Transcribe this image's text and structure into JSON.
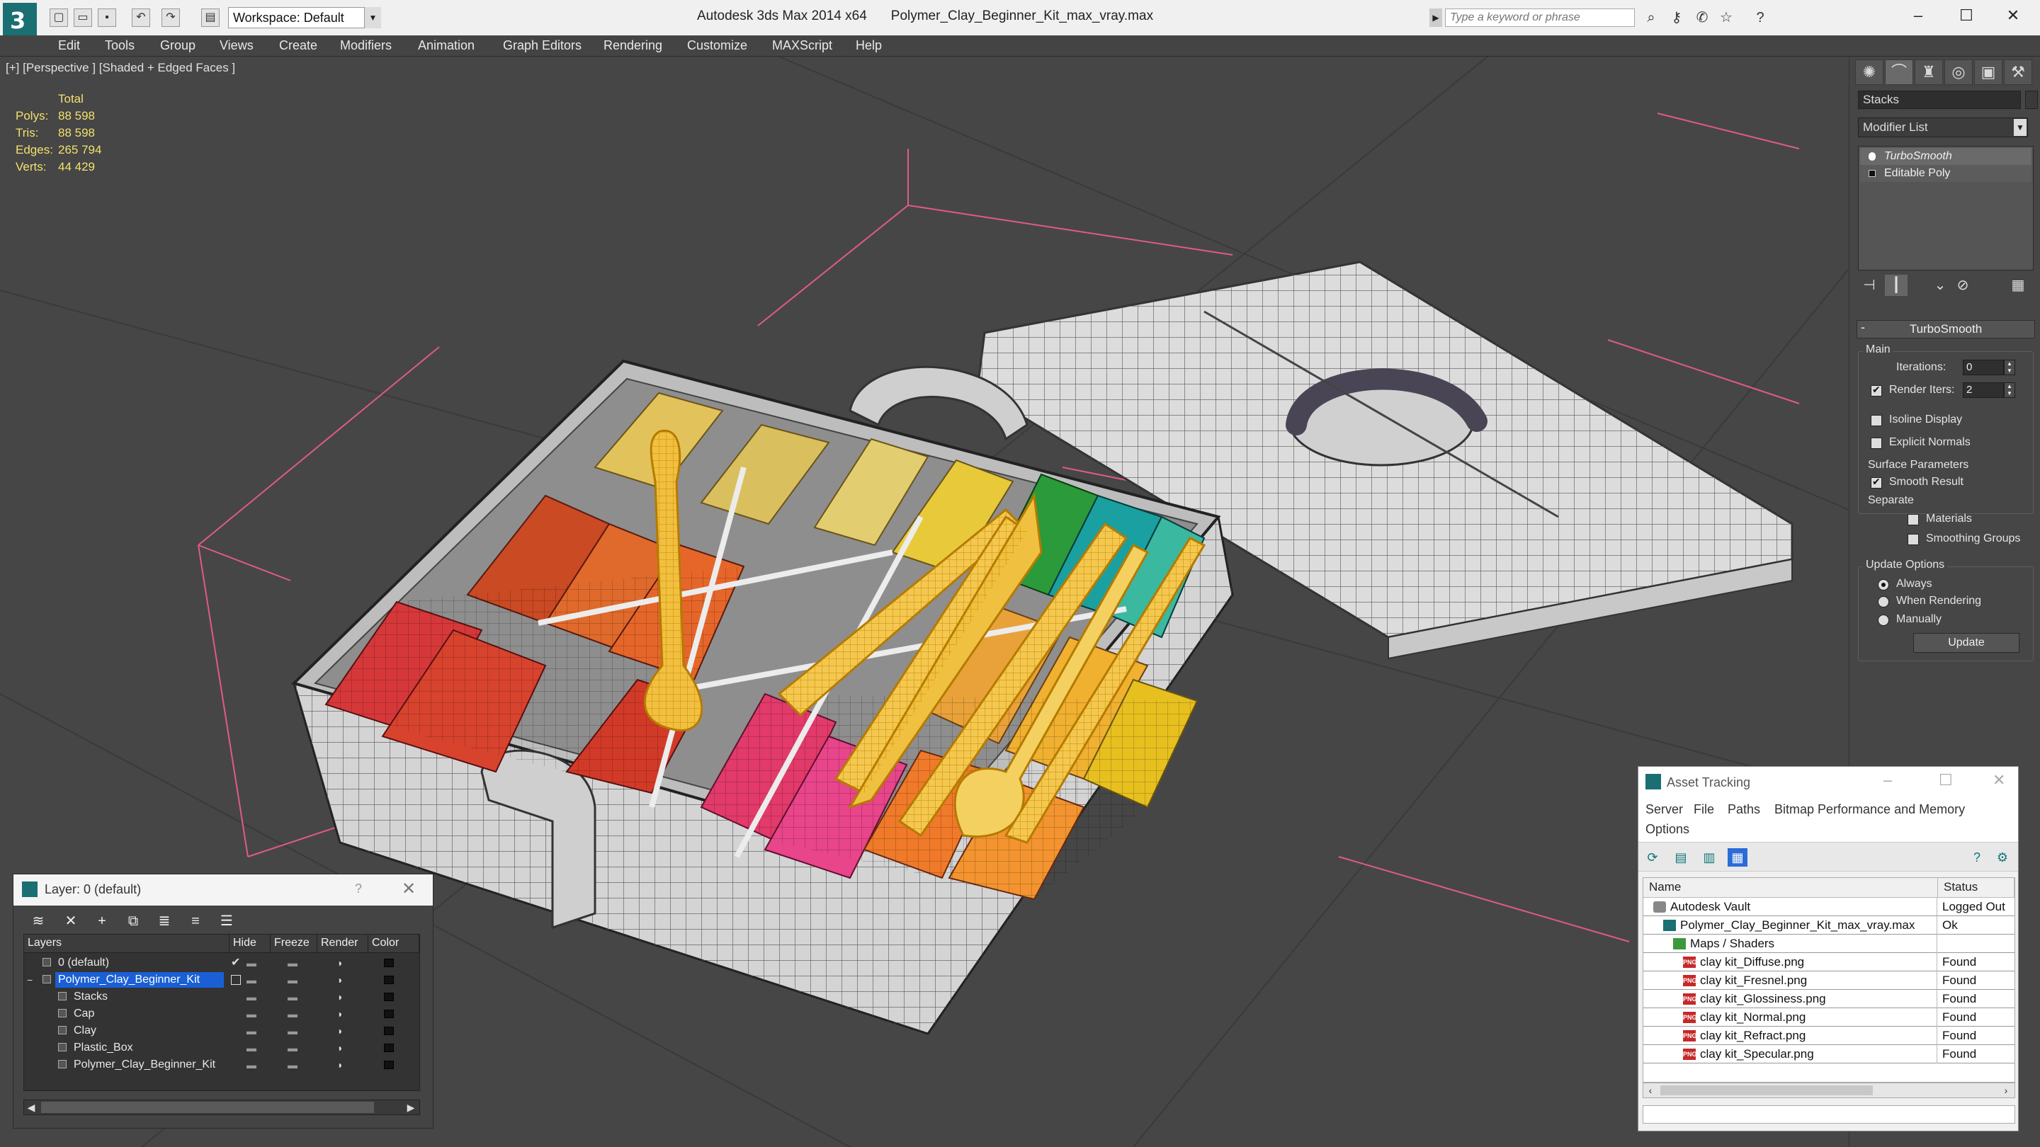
{
  "titlebar": {
    "workspace": "Workspace: Default",
    "app_name": "Autodesk 3ds Max  2014 x64",
    "file_name": "Polymer_Clay_Beginner_Kit_max_vray.max",
    "search_placeholder": "Type a keyword or phrase"
  },
  "menu": {
    "items": [
      "Edit",
      "Tools",
      "Group",
      "Views",
      "Create",
      "Modifiers",
      "Animation",
      "Graph Editors",
      "Rendering",
      "Customize",
      "MAXScript",
      "Help"
    ]
  },
  "viewport": {
    "label": "[+] [Perspective ] [Shaded + Edged Faces ]",
    "stats": {
      "header": "Total",
      "rows": [
        {
          "label": "Polys:",
          "value": "88 598"
        },
        {
          "label": "Tris:",
          "value": "88 598"
        },
        {
          "label": "Edges:",
          "value": "265 794"
        },
        {
          "label": "Verts:",
          "value": "44 429"
        }
      ]
    }
  },
  "command_panel": {
    "stack_name": "Stacks",
    "modifier_list": "Modifier List",
    "stack": [
      "TurboSmooth",
      "Editable Poly"
    ],
    "rollout": "TurboSmooth",
    "main": {
      "title": "Main",
      "iterations_label": "Iterations:",
      "iterations_value": "0",
      "render_iters_label": "Render Iters:",
      "render_iters_value": "2",
      "render_iters_checked": true,
      "isoline": "Isoline Display",
      "explicit_normals": "Explicit Normals"
    },
    "surface": {
      "title": "Surface Parameters",
      "smooth_result": "Smooth Result",
      "separate": "Separate",
      "materials": "Materials",
      "smoothing_groups": "Smoothing Groups"
    },
    "update": {
      "title": "Update Options",
      "always": "Always",
      "when_rendering": "When Rendering",
      "manually": "Manually",
      "button": "Update"
    }
  },
  "layer_dialog": {
    "title": "Layer: 0 (default)",
    "help": "?",
    "columns": {
      "layers": "Layers",
      "hide": "Hide",
      "freeze": "Freeze",
      "render": "Render",
      "color": "Color"
    },
    "rows": [
      {
        "name": "0 (default)",
        "level": 0
      },
      {
        "name": "Polymer_Clay_Beginner_Kit",
        "level": 0
      },
      {
        "name": "Stacks",
        "level": 1
      },
      {
        "name": "Cap",
        "level": 1
      },
      {
        "name": "Clay",
        "level": 1
      },
      {
        "name": "Plastic_Box",
        "level": 1
      },
      {
        "name": "Polymer_Clay_Beginner_Kit",
        "level": 1
      }
    ]
  },
  "asset_dialog": {
    "title": "Asset Tracking",
    "menu": [
      "Server",
      "File",
      "Paths",
      "Bitmap Performance and Memory",
      "Options"
    ],
    "columns": {
      "name": "Name",
      "status": "Status"
    },
    "rows": [
      {
        "name": "Autodesk Vault",
        "status": "Logged Out",
        "indent": 0,
        "icon": "vault"
      },
      {
        "name": "Polymer_Clay_Beginner_Kit_max_vray.max",
        "status": "Ok",
        "indent": 1,
        "icon": "max"
      },
      {
        "name": "Maps / Shaders",
        "status": "",
        "indent": 2,
        "icon": "maps"
      },
      {
        "name": "clay kit_Diffuse.png",
        "status": "Found",
        "indent": 3,
        "icon": "png"
      },
      {
        "name": "clay kit_Fresnel.png",
        "status": "Found",
        "indent": 3,
        "icon": "png"
      },
      {
        "name": "clay kit_Glossiness.png",
        "status": "Found",
        "indent": 3,
        "icon": "png"
      },
      {
        "name": "clay kit_Normal.png",
        "status": "Found",
        "indent": 3,
        "icon": "png"
      },
      {
        "name": "clay kit_Refract.png",
        "status": "Found",
        "indent": 3,
        "icon": "png"
      },
      {
        "name": "clay kit_Specular.png",
        "status": "Found",
        "indent": 3,
        "icon": "png"
      }
    ]
  }
}
